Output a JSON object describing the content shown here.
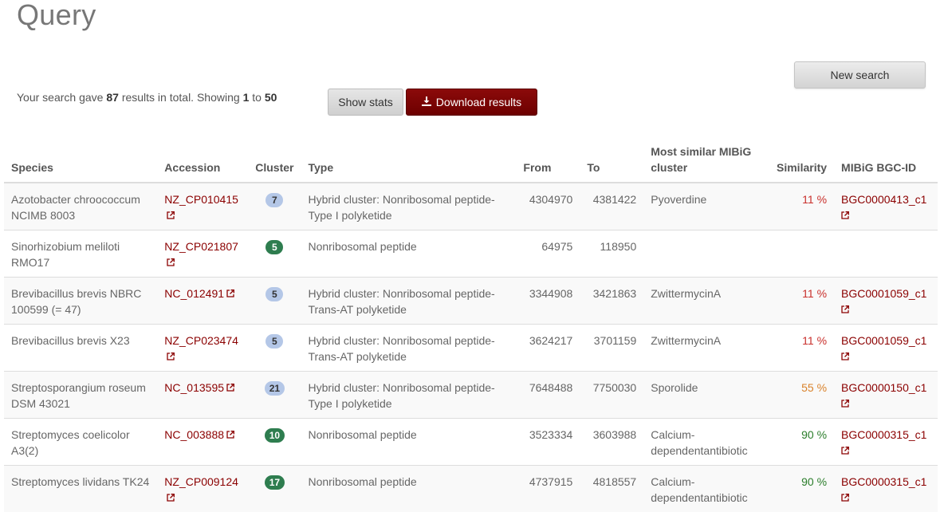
{
  "page": {
    "title": "Query"
  },
  "summary": {
    "prefix": "Your search gave",
    "total": "87",
    "mid": "results in total. Showing",
    "start": "1",
    "to": "to",
    "end": "50"
  },
  "buttons": {
    "show_stats": "Show stats",
    "download": "Download results",
    "new_search": "New search"
  },
  "table": {
    "headers": {
      "species": "Species",
      "accession": "Accession",
      "cluster": "Cluster",
      "type": "Type",
      "from": "From",
      "to": "To",
      "mibig": "Most similar MIBiG cluster",
      "similarity": "Similarity",
      "bgc": "MIBiG BGC-ID"
    },
    "rows": [
      {
        "species": "Azotobacter chroococcum NCIMB 8003",
        "accession": "NZ_CP010415",
        "cluster": "7",
        "badge": "blue",
        "type": "Hybrid cluster: Nonribosomal peptide-Type I polyketide",
        "from": "4304970",
        "to": "4381422",
        "mibig": "Pyoverdine",
        "similarity": "11 %",
        "sim_color": "red",
        "bgc": "BGC0000413_c1"
      },
      {
        "species": "Sinorhizobium meliloti RMO17",
        "accession": "NZ_CP021807",
        "cluster": "5",
        "badge": "green",
        "type": "Nonribosomal peptide",
        "from": "64975",
        "to": "118950",
        "mibig": "",
        "similarity": "",
        "sim_color": "",
        "bgc": ""
      },
      {
        "species": "Brevibacillus brevis NBRC 100599 (= 47)",
        "accession": "NC_012491",
        "cluster": "5",
        "badge": "blue",
        "type": "Hybrid cluster: Nonribosomal peptide-Trans-AT polyketide",
        "from": "3344908",
        "to": "3421863",
        "mibig": "ZwittermycinA",
        "similarity": "11 %",
        "sim_color": "red",
        "bgc": "BGC0001059_c1"
      },
      {
        "species": "Brevibacillus brevis X23",
        "accession": "NZ_CP023474",
        "cluster": "5",
        "badge": "blue",
        "type": "Hybrid cluster: Nonribosomal peptide-Trans-AT polyketide",
        "from": "3624217",
        "to": "3701159",
        "mibig": "ZwittermycinA",
        "similarity": "11 %",
        "sim_color": "red",
        "bgc": "BGC0001059_c1"
      },
      {
        "species": "Streptosporangium roseum DSM 43021",
        "accession": "NC_013595",
        "cluster": "21",
        "badge": "blue",
        "type": "Hybrid cluster: Nonribosomal peptide-Type I polyketide",
        "from": "7648488",
        "to": "7750030",
        "mibig": "Sporolide",
        "similarity": "55 %",
        "sim_color": "orange",
        "bgc": "BGC0000150_c1"
      },
      {
        "species": "Streptomyces coelicolor A3(2)",
        "accession": "NC_003888",
        "cluster": "10",
        "badge": "green",
        "type": "Nonribosomal peptide",
        "from": "3523334",
        "to": "3603988",
        "mibig": "Calcium-dependentantibiotic",
        "similarity": "90 %",
        "sim_color": "green",
        "bgc": "BGC0000315_c1"
      },
      {
        "species": "Streptomyces lividans TK24",
        "accession": "NZ_CP009124",
        "cluster": "17",
        "badge": "green",
        "type": "Nonribosomal peptide",
        "from": "4737915",
        "to": "4818557",
        "mibig": "Calcium-dependentantibiotic",
        "similarity": "90 %",
        "sim_color": "green",
        "bgc": "BGC0000315_c1"
      }
    ]
  },
  "colors": {
    "accent": "#8b0000",
    "badge_blue": "#b4c7e7",
    "badge_green": "#2e7d4f",
    "sim_red": "#c9302c",
    "sim_orange": "#d9822b",
    "sim_green": "#2a7d2a"
  },
  "icons": {
    "external_link": "external-link-icon",
    "download": "download-icon"
  }
}
